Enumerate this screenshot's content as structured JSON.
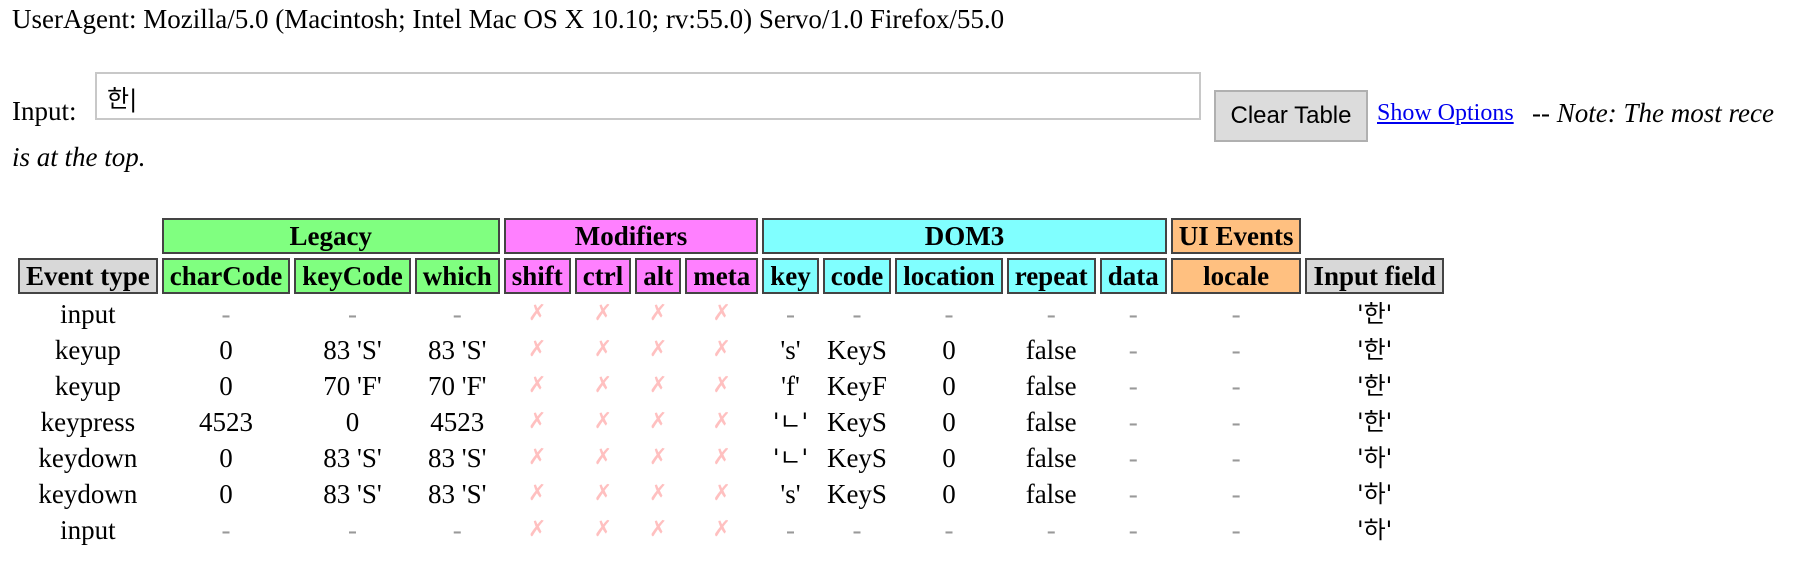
{
  "user_agent": "UserAgent: Mozilla/5.0 (Macintosh; Intel Mac OS X 10.10; rv:55.0) Servo/1.0 Firefox/55.0",
  "input": {
    "label": "Input:",
    "value": "한|"
  },
  "clear_button": "Clear Table",
  "show_options_link": "Show Options",
  "note": {
    "dashes": " -- ",
    "italic_1": "Note: The most rece",
    "italic_2": "is at the top."
  },
  "table": {
    "groups": {
      "legacy": "Legacy",
      "modifiers": "Modifiers",
      "dom3": "DOM3",
      "ui_events": "UI Events"
    },
    "headers": {
      "event_type": "Event type",
      "charCode": "charCode",
      "keyCode": "keyCode",
      "which": "which",
      "shift": "shift",
      "ctrl": "ctrl",
      "alt": "alt",
      "meta": "meta",
      "key": "key",
      "code": "code",
      "location": "location",
      "repeat": "repeat",
      "data": "data",
      "locale": "locale",
      "input_field": "Input field"
    },
    "rows": [
      {
        "event": "input",
        "charCode": "-",
        "keyCode": "-",
        "which": "-",
        "shift": "✗",
        "ctrl": "✗",
        "alt": "✗",
        "meta": "✗",
        "key": "-",
        "code": "-",
        "location": "-",
        "repeat": "-",
        "data": "-",
        "locale": "-",
        "field": "'한'"
      },
      {
        "event": "keyup",
        "charCode": "0",
        "keyCode": "83 'S'",
        "which": "83 'S'",
        "shift": "✗",
        "ctrl": "✗",
        "alt": "✗",
        "meta": "✗",
        "key": "'s'",
        "code": "KeyS",
        "location": "0",
        "repeat": "false",
        "data": "-",
        "locale": "-",
        "field": "'한'"
      },
      {
        "event": "keyup",
        "charCode": "0",
        "keyCode": "70 'F'",
        "which": "70 'F'",
        "shift": "✗",
        "ctrl": "✗",
        "alt": "✗",
        "meta": "✗",
        "key": "'f'",
        "code": "KeyF",
        "location": "0",
        "repeat": "false",
        "data": "-",
        "locale": "-",
        "field": "'한'"
      },
      {
        "event": "keypress",
        "charCode": "4523",
        "keyCode": "0",
        "which": "4523",
        "shift": "✗",
        "ctrl": "✗",
        "alt": "✗",
        "meta": "✗",
        "key": "'ㄴ'",
        "code": "KeyS",
        "location": "0",
        "repeat": "false",
        "data": "-",
        "locale": "-",
        "field": "'한'"
      },
      {
        "event": "keydown",
        "charCode": "0",
        "keyCode": "83 'S'",
        "which": "83 'S'",
        "shift": "✗",
        "ctrl": "✗",
        "alt": "✗",
        "meta": "✗",
        "key": "'ㄴ'",
        "code": "KeyS",
        "location": "0",
        "repeat": "false",
        "data": "-",
        "locale": "-",
        "field": "'하'"
      },
      {
        "event": "keydown",
        "charCode": "0",
        "keyCode": "83 'S'",
        "which": "83 'S'",
        "shift": "✗",
        "ctrl": "✗",
        "alt": "✗",
        "meta": "✗",
        "key": "'s'",
        "code": "KeyS",
        "location": "0",
        "repeat": "false",
        "data": "-",
        "locale": "-",
        "field": "'하'"
      },
      {
        "event": "input",
        "charCode": "-",
        "keyCode": "-",
        "which": "-",
        "shift": "✗",
        "ctrl": "✗",
        "alt": "✗",
        "meta": "✗",
        "key": "-",
        "code": "-",
        "location": "-",
        "repeat": "-",
        "data": "-",
        "locale": "-",
        "field": "'하'"
      }
    ]
  },
  "colors": {
    "legacy": "#80ff80",
    "modifiers": "#ff80ff",
    "dom3": "#80ffff",
    "ui_events": "#ffc080",
    "gray_header": "#d8d8d8",
    "link": "#0000ee",
    "modifier_x": "#ffc0c0"
  }
}
